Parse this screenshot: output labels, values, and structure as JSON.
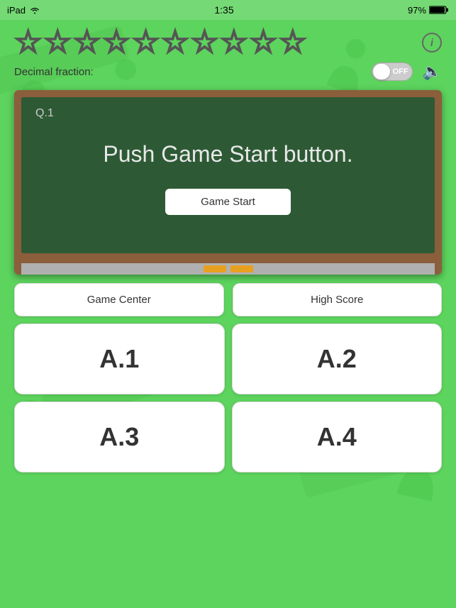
{
  "status_bar": {
    "left": "iPad",
    "time": "1:35",
    "battery": "97%"
  },
  "stars": {
    "count": 10,
    "filled": 0,
    "label": "Stars"
  },
  "info_button": {
    "label": "i"
  },
  "toggle": {
    "label": "Decimal fraction:",
    "state": "OFF"
  },
  "chalkboard": {
    "question_label": "Q.1",
    "message": "Push Game Start button.",
    "game_start_label": "Game Start"
  },
  "buttons": {
    "game_center_label": "Game Center",
    "high_score_label": "High Score",
    "answers": [
      {
        "label": "A.1"
      },
      {
        "label": "A.2"
      },
      {
        "label": "A.3"
      },
      {
        "label": "A.4"
      }
    ]
  },
  "colors": {
    "bg_green": "#5dd45d",
    "chalkboard_green": "#2d5a35",
    "chalkboard_brown": "#8B5E3C"
  }
}
